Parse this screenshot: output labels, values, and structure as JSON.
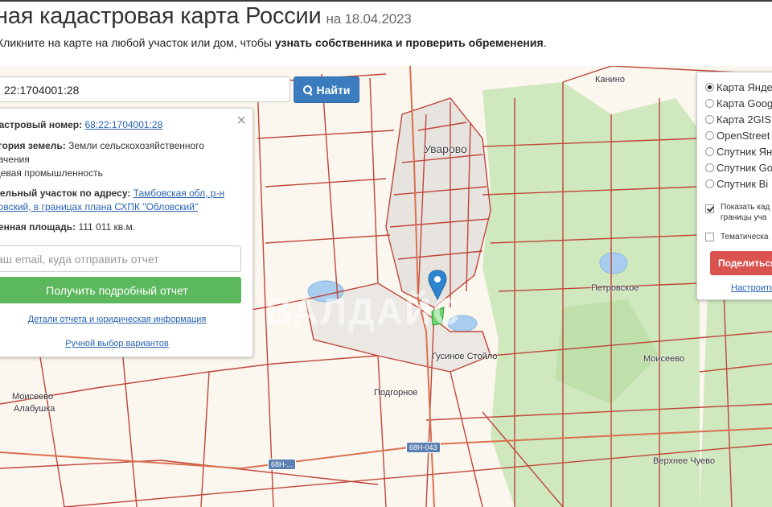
{
  "header": {
    "title": "ная кадастровая карта России",
    "date": "на 18.04.2023",
    "subtitle_prefix": "Кликните на карте на любой участок или дом, чтобы ",
    "subtitle_bold": "узнать собственника и проверить обременения",
    "subtitle_suffix": "."
  },
  "search": {
    "value": "22:1704001:28",
    "button_label": "Найти",
    "button_icon": "search-icon"
  },
  "info_panel": {
    "cadastral_label": "дастровый номер:",
    "cadastral_value": "68:22:1704001:28",
    "category_label": "егория земель:",
    "category_value_1": "Земли сельскохозяйственного",
    "category_value_2": "начения",
    "category_value_3": "щевая промышленность",
    "address_label": "мельный участок по адресу:",
    "address_value_1": "Тамбовская обл, р-н",
    "address_value_2": "ровский, в границах плана СХПК \"Обловский\"",
    "area_label": "ченная площадь:",
    "area_value": "111 011 кв.м.",
    "email_placeholder": "аш email, куда отправить отчет",
    "report_button": "Получить подробный отчет",
    "details_link": "Детали отчета и юридическая информация",
    "manual_link": "Ручной выбор вариантов",
    "close_icon": "×"
  },
  "layers_panel": {
    "options": [
      {
        "label": "Карта Янде",
        "selected": true
      },
      {
        "label": "Карта Goog",
        "selected": false
      },
      {
        "label": "Карта 2GIS",
        "selected": false
      },
      {
        "label": "OpenStreet",
        "selected": false
      },
      {
        "label": "Спутник Ян",
        "selected": false
      },
      {
        "label": "Спутник Go",
        "selected": false
      },
      {
        "label": "Спутник Bi",
        "selected": false
      }
    ],
    "show_borders_line1": "Показать кад",
    "show_borders_line2": "границы уча",
    "show_borders_checked": true,
    "thematic_label": "Тематическа",
    "thematic_checked": false,
    "share_button": "Поделиться",
    "configure_link": "Настроить"
  },
  "map": {
    "places": {
      "kanino": "Канино",
      "uvarovo": "Уварово",
      "petrovskoe": "Петровское",
      "gusinoe": "Гусиное Стойло",
      "podgornoe": "Подгорное",
      "moiseevo_left": "Моисеево",
      "alabushka": "Алабушка",
      "moiseevo_right": "Моисеево",
      "verhnee": "Верхнее Чуево"
    },
    "roads": {
      "r1": "68Н-043",
      "r2": "68Н-..."
    },
    "watermark": "ВАЛДАЙС"
  }
}
